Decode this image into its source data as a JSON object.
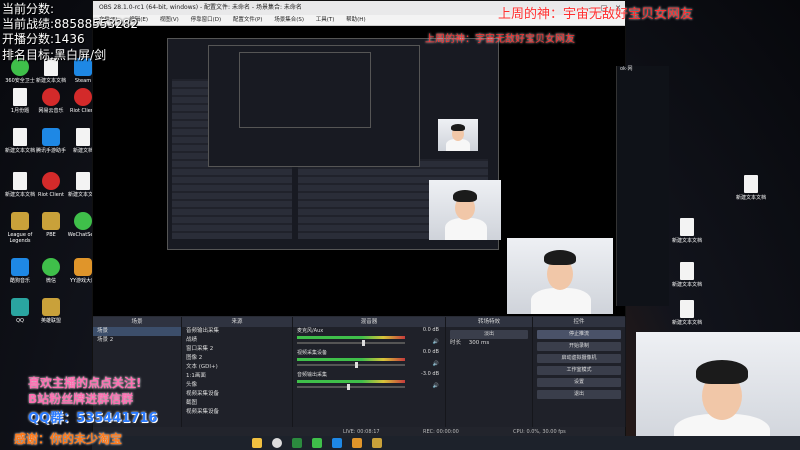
{
  "overlay": {
    "top_left_lines": [
      {
        "label": "当前分数:"
      },
      {
        "label": "当前战绩:",
        "value": "88588553282"
      },
      {
        "label": "开播分数:",
        "value": "1436"
      },
      {
        "label": "排名目标:",
        "value": "黑白屏/剑"
      }
    ],
    "top_right_banner": "上周的神：宇宙无敌好宝贝女网友",
    "follow_text": "喜欢主播的点点关注!",
    "join_text": "B站粉丝牌进群信群",
    "qq_group": "QQ群：535441716",
    "thanks_text": "感谢：你的未少淘宝"
  },
  "desktop_icons": [
    {
      "label": "360安全卫士",
      "color": "green",
      "style": "green"
    },
    {
      "label": "新建文本文档",
      "color": "doc",
      "style": "doc"
    },
    {
      "label": "Steam",
      "color": "blue",
      "style": "blue"
    },
    {
      "label": "1月份题",
      "color": "doc",
      "style": "doc"
    },
    {
      "label": "网易云音乐",
      "color": "red",
      "style": "red"
    },
    {
      "label": "Riot Client",
      "color": "red",
      "style": "red"
    },
    {
      "label": "新建文本文档",
      "color": "doc",
      "style": "doc"
    },
    {
      "label": "腾讯手游助手",
      "color": "blue",
      "style": "blue"
    },
    {
      "label": "新建文档",
      "color": "doc",
      "style": "doc"
    },
    {
      "label": "新建文本文档",
      "color": "doc",
      "style": "doc"
    },
    {
      "label": "Riot Client",
      "color": "red",
      "style": "red"
    },
    {
      "label": "新建文本文档",
      "color": "doc",
      "style": "doc"
    },
    {
      "label": "League of Legends",
      "color": "gold",
      "style": "gold"
    },
    {
      "label": "PBE",
      "color": "gold",
      "style": "gold"
    },
    {
      "label": "WeChatSe...",
      "color": "green",
      "style": "green"
    },
    {
      "label": "酷狗音乐",
      "color": "blue",
      "style": "blue"
    },
    {
      "label": "微信",
      "color": "green",
      "style": "green"
    },
    {
      "label": "YY游戏大厅",
      "color": "orange",
      "style": "orange"
    },
    {
      "label": "QQ",
      "color": "teal",
      "style": "teal"
    },
    {
      "label": "英雄联盟",
      "color": "gold",
      "style": "gold"
    }
  ],
  "obs": {
    "title": "OBS 28.1.0-rc1 (64-bit, windows) - 配置文件: 未命名 - 场景集合: 未命名",
    "menu": [
      "文件(F)",
      "编辑(E)",
      "视图(V)",
      "停靠窗口(D)",
      "配置文件(P)",
      "场景集合(S)",
      "工具(T)",
      "帮助(H)"
    ],
    "docks": {
      "scenes": {
        "title": "场景",
        "items": [
          "场景",
          "场景 2"
        ]
      },
      "sources": {
        "title": "来源",
        "items": [
          "音频输出采集",
          "战绩",
          "窗口采集 2",
          "图像 2",
          "文本 (GDI+)",
          "1:1画面",
          "头像",
          "视频采集设备",
          "截图",
          "视频采集设备"
        ]
      },
      "mixer": {
        "title": "混音器",
        "channels": [
          {
            "name": "麦克风/Aux",
            "db": "0.0 dB",
            "level": 0.62
          },
          {
            "name": "视频采集设备",
            "db": "0.0 dB",
            "level": 0.55
          },
          {
            "name": "音频输出采集",
            "db": "-3.0 dB",
            "level": 0.48
          }
        ]
      },
      "transitions": {
        "title": "转场特效",
        "type": "淡出",
        "duration_label": "时长",
        "duration": "300 ms"
      },
      "controls": {
        "title": "控件",
        "buttons": [
          "停止推流",
          "开始录制",
          "启动虚拟摄像机",
          "工作室模式",
          "设置",
          "退出"
        ]
      }
    },
    "status": {
      "live": "LIVE: 00:08:17",
      "rec": "REC: 00:00:00",
      "cpu": "CPU: 0.0%, 30.00 fps"
    }
  },
  "taskbar": {
    "icons": [
      "file-explorer",
      "obs",
      "browser",
      "wechat",
      "qq",
      "chrome",
      "game"
    ]
  }
}
